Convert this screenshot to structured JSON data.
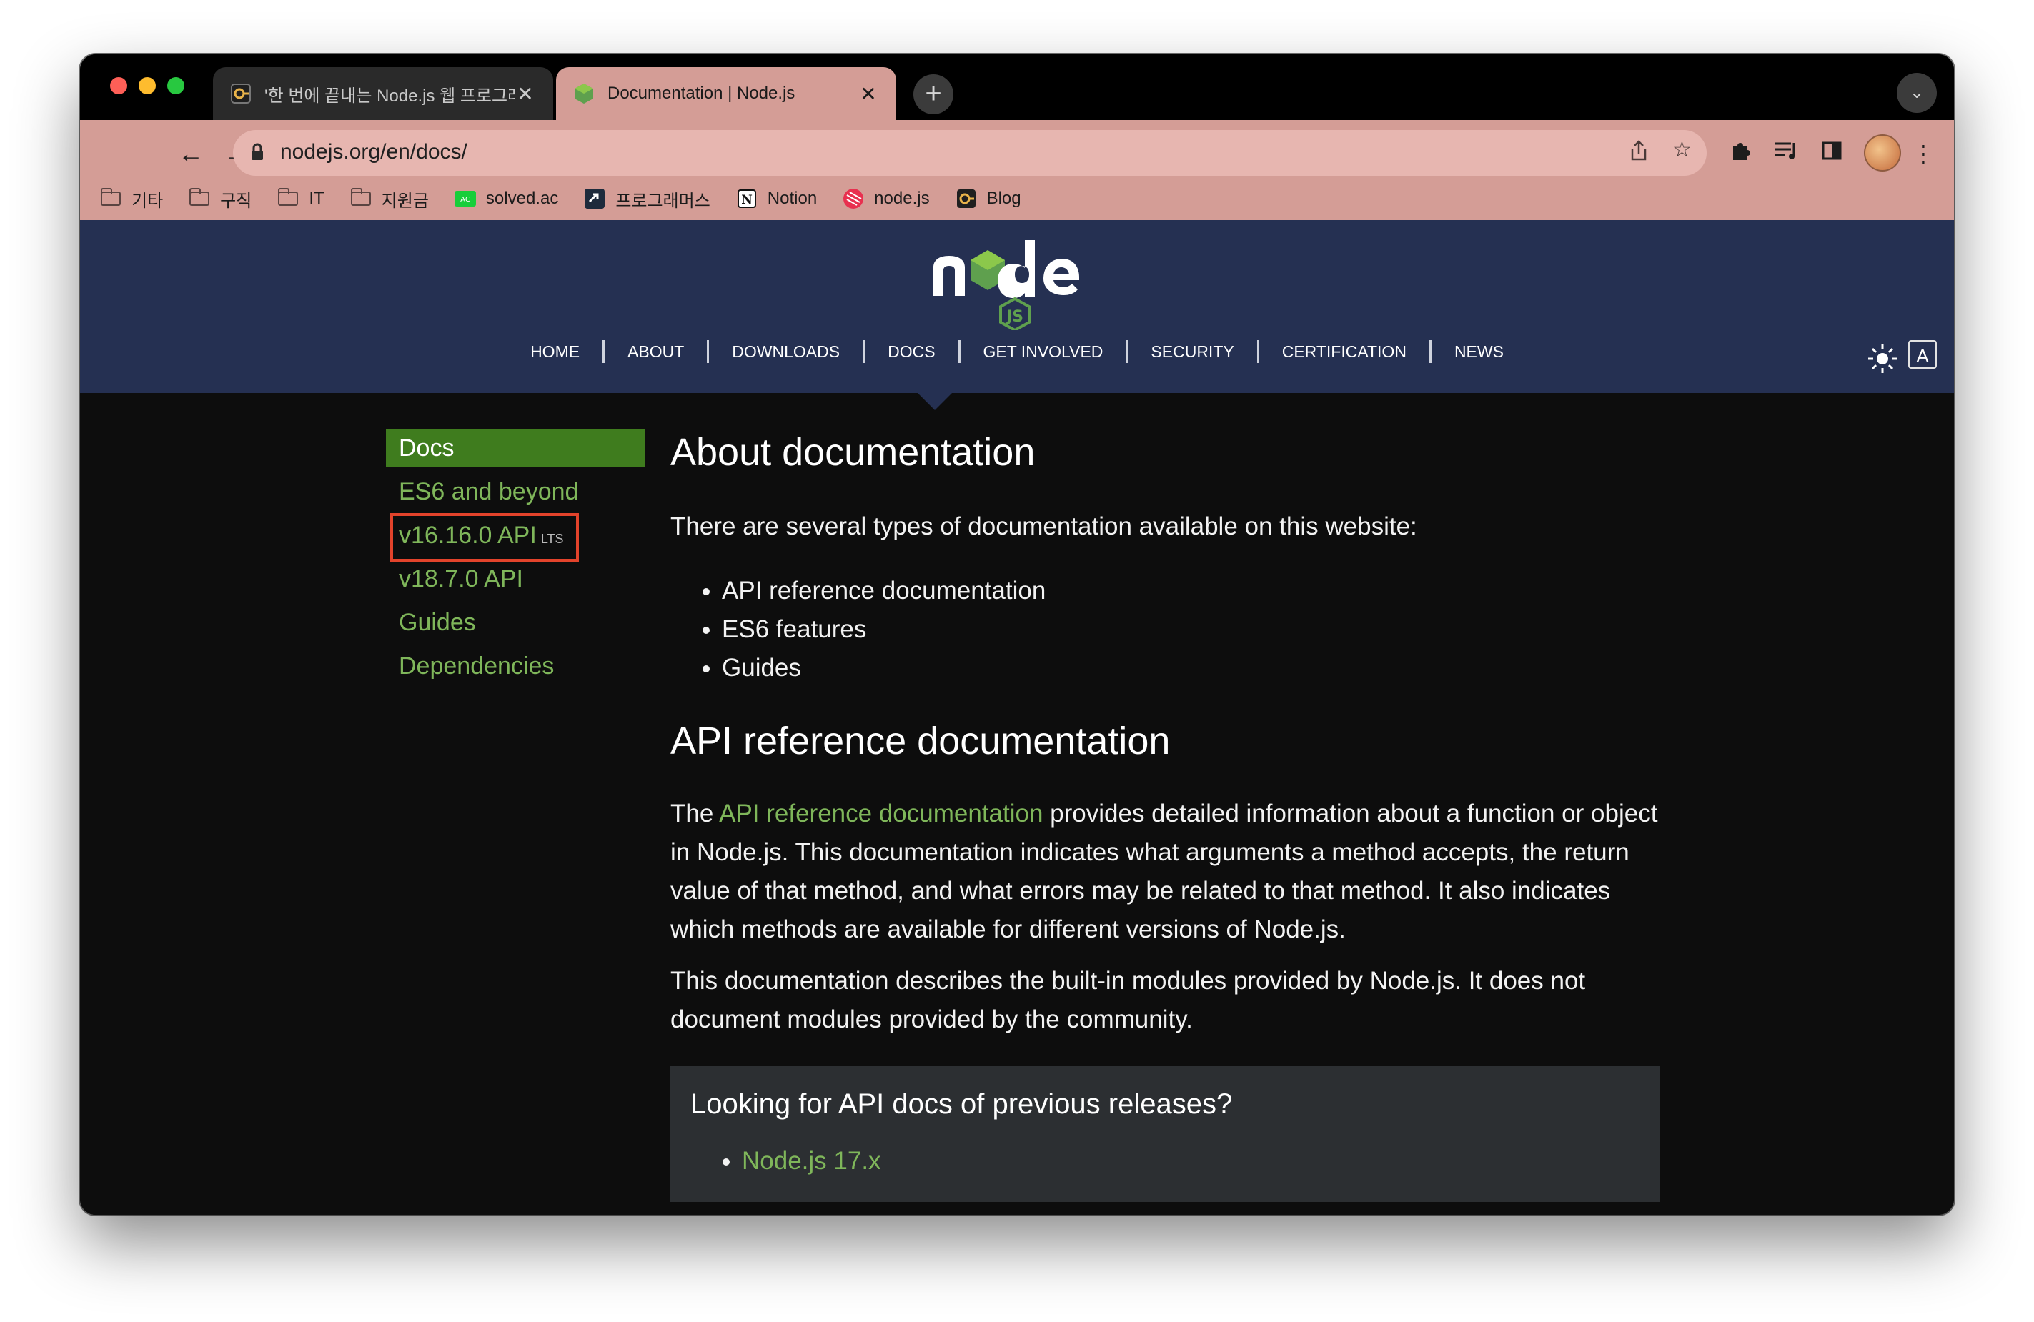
{
  "browser": {
    "tabs": [
      {
        "title": "'한 번에 끝내는 Node.js 웹 프로그래",
        "favicon": "inflearn-icon",
        "active": false
      },
      {
        "title": "Documentation | Node.js",
        "favicon": "nodejs-icon",
        "active": true
      }
    ],
    "new_tab_label": "+",
    "url": "nodejs.org/en/docs/",
    "bookmarks": [
      {
        "label": "기타",
        "icon": "folder-icon"
      },
      {
        "label": "구직",
        "icon": "folder-icon"
      },
      {
        "label": "IT",
        "icon": "folder-icon"
      },
      {
        "label": "지원금",
        "icon": "folder-icon"
      },
      {
        "label": "solved.ac",
        "icon": "solvedac-icon"
      },
      {
        "label": "프로그래머스",
        "icon": "programmers-icon"
      },
      {
        "label": "Notion",
        "icon": "notion-icon"
      },
      {
        "label": "node.js",
        "icon": "nodejs-bookmark-icon"
      },
      {
        "label": "Blog",
        "icon": "inflearn-icon"
      }
    ]
  },
  "site": {
    "nav": [
      "HOME",
      "ABOUT",
      "DOWNLOADS",
      "DOCS",
      "GET INVOLVED",
      "SECURITY",
      "CERTIFICATION",
      "NEWS"
    ],
    "active_nav": "DOCS"
  },
  "sidebar": {
    "items": [
      {
        "label": "Docs",
        "active": true
      },
      {
        "label": "ES6 and beyond"
      },
      {
        "label": "v16.16.0 API",
        "badge": "LTS",
        "highlighted": true
      },
      {
        "label": "v18.7.0 API"
      },
      {
        "label": "Guides"
      },
      {
        "label": "Dependencies"
      }
    ]
  },
  "content": {
    "title": "About documentation",
    "intro": "There are several types of documentation available on this website:",
    "types": [
      "API reference documentation",
      "ES6 features",
      "Guides"
    ],
    "api_heading": "API reference documentation",
    "api_p1_before": "The ",
    "api_p1_link": "API reference documentation",
    "api_p1_after": " provides detailed information about a function or object in Node.js. This documentation indicates what arguments a method accepts, the return value of that method, and what errors may be related to that method. It also indicates which methods are available for different versions of Node.js.",
    "api_p2": "This documentation describes the built-in modules provided by Node.js. It does not document modules provided by the community.",
    "callout_title": "Looking for API docs of previous releases?",
    "callout_links": [
      "Node.js 17.x"
    ]
  },
  "colors": {
    "toolbar": "#d49d96",
    "header": "#253052",
    "accent_green": "#7fb65a",
    "active_green": "#3f7c1e",
    "highlight_box": "#e2432b"
  }
}
